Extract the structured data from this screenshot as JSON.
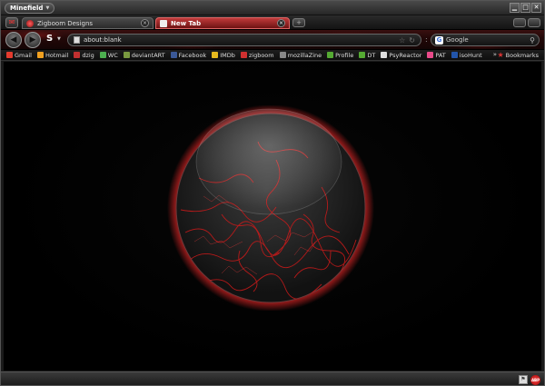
{
  "app": {
    "menu_label": "Minefield"
  },
  "window_controls": {
    "minimize": "▁",
    "maximize": "□",
    "close": "✕"
  },
  "tabs": [
    {
      "label": "Zigboom Designs",
      "active": false
    },
    {
      "label": "New Tab",
      "active": true
    }
  ],
  "nav": {
    "stylish_label": "S",
    "url_value": "about:blank",
    "search_engine": "Google",
    "search_value": "Google"
  },
  "bookmarks": [
    {
      "label": "Gmail",
      "color": "#e33b2e"
    },
    {
      "label": "Hotmail",
      "color": "#f0a020"
    },
    {
      "label": "dzig",
      "color": "#c03030"
    },
    {
      "label": "WC",
      "color": "#4caf50"
    },
    {
      "label": "deviantART",
      "color": "#7a9a40"
    },
    {
      "label": "Facebook",
      "color": "#3b5998"
    },
    {
      "label": "IMDb",
      "color": "#e6b91e"
    },
    {
      "label": "zigboom",
      "color": "#d03030"
    },
    {
      "label": "mozillaZine",
      "color": "#888888"
    },
    {
      "label": "Profile",
      "color": "#55aa33"
    },
    {
      "label": "DT",
      "color": "#55aa33"
    },
    {
      "label": "PsyReactor",
      "color": "#dddddd"
    },
    {
      "label": "PAT",
      "color": "#e84a8a"
    },
    {
      "label": "isoHunt",
      "color": "#2255aa"
    }
  ],
  "bookmarks_folder": "Bookmarks",
  "colors": {
    "accent": "#c03a3a",
    "glow": "#ff2a2a"
  },
  "status": {
    "addon_badge": "ABP"
  }
}
